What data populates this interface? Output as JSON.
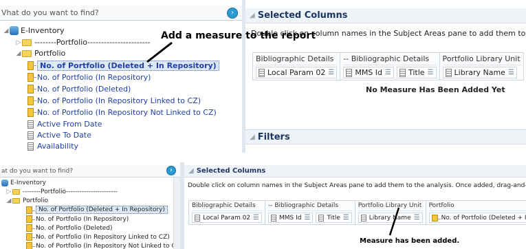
{
  "top": {
    "search_text": "Vhat do you want to find?",
    "tree": [
      {
        "key": "root",
        "label": "E-Inventory"
      },
      {
        "key": "f1",
        "label": "--------Portfolio-----------------------"
      },
      {
        "key": "f2",
        "label": "Portfolio"
      },
      {
        "key": "m1",
        "label": "No. of Portfolio (Deleted + In Repository)"
      },
      {
        "key": "m2",
        "label": "No. of Portfolio (In Repository)"
      },
      {
        "key": "m3",
        "label": "No. of Portfolio (Deleted)"
      },
      {
        "key": "m4",
        "label": "No. of Portfolio (In Repository Linked to CZ)"
      },
      {
        "key": "m5",
        "label": "No. of Portfolio (In Repository Not Linked to CZ)"
      },
      {
        "key": "a1",
        "label": "Active From Date"
      },
      {
        "key": "a2",
        "label": "Active To Date"
      },
      {
        "key": "a3",
        "label": "Availability"
      }
    ],
    "selected_columns_title": "Selected Columns",
    "instruction": "Double click on column names in the Subject Areas pane to add them to the analysi",
    "callout": "Add a measure to the report",
    "column_groups": [
      {
        "header": "Bibliographic Details",
        "chips": [
          "Local Param 02"
        ]
      },
      {
        "header": "-- Bibliographic Details",
        "chips": [
          "MMS Id",
          "Title"
        ]
      },
      {
        "header": "Portfolio Library Unit",
        "chips": [
          "Library Name"
        ]
      }
    ],
    "empty_msg": "No Measure Has Been Added Yet",
    "filters_title": "Filters"
  },
  "bottom": {
    "search_text": "at do you want to find?",
    "tree": [
      {
        "key": "root",
        "label": "E-Inventory"
      },
      {
        "key": "f1",
        "label": "--------Portfolio-----------------------"
      },
      {
        "key": "f2",
        "label": "Portfolio"
      },
      {
        "key": "m1",
        "label": "No. of Portfolio (Deleted + In Repository)"
      },
      {
        "key": "m2",
        "label": "No. of Portfolio (In Repository)"
      },
      {
        "key": "m3",
        "label": "No. of Portfolio (Deleted)"
      },
      {
        "key": "m4",
        "label": "No. of Portfolio (In Repository Linked to CZ)"
      },
      {
        "key": "m5",
        "label": "No. of Portfolio (In Repository Not Linked to CZ)"
      }
    ],
    "selected_columns_title": "Selected Columns",
    "instruction": "Double click on column names in the Subject Areas pane to add them to the analysis. Once added, drag-and-drop columns to reorder",
    "column_groups": [
      {
        "header": "Bibliographic Details",
        "chips": [
          "Local Param 02"
        ]
      },
      {
        "header": "-- Bibliographic Details",
        "chips": [
          "MMS Id",
          "Title"
        ]
      },
      {
        "header": "Portfolio Library Unit",
        "chips": [
          "Library Name"
        ]
      },
      {
        "header": "Portfolio",
        "chips": [
          "No. of Portfolio (Deleted + In Repository)"
        ]
      }
    ],
    "callout": "Measure has been added."
  }
}
